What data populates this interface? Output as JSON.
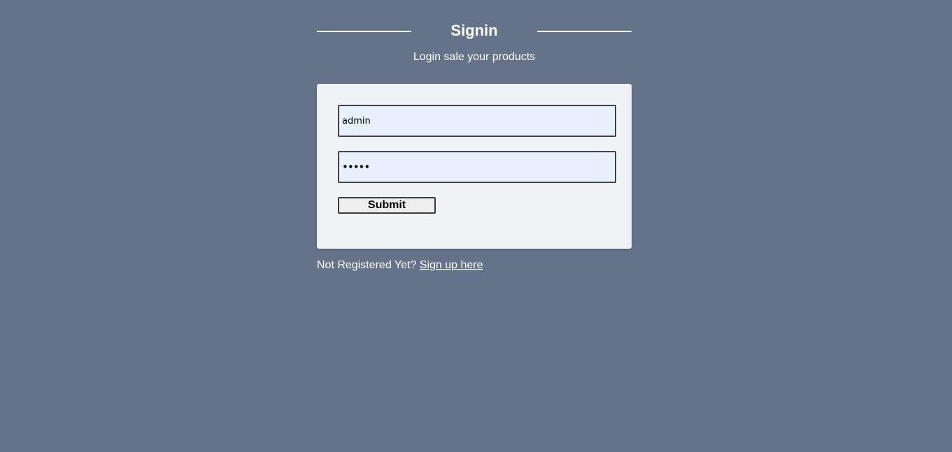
{
  "header": {
    "title": "Signin",
    "subtitle": "Login sale your products"
  },
  "form": {
    "username_value": "admin",
    "password_value": "admin",
    "submit_label": "Submit"
  },
  "footer": {
    "prompt": "Not Registered Yet?",
    "link_label": "Sign up here"
  },
  "colors": {
    "background": "#647389",
    "card": "#f0f2f5",
    "input_fill": "#e8f0fe",
    "text_light": "#ffffff"
  }
}
